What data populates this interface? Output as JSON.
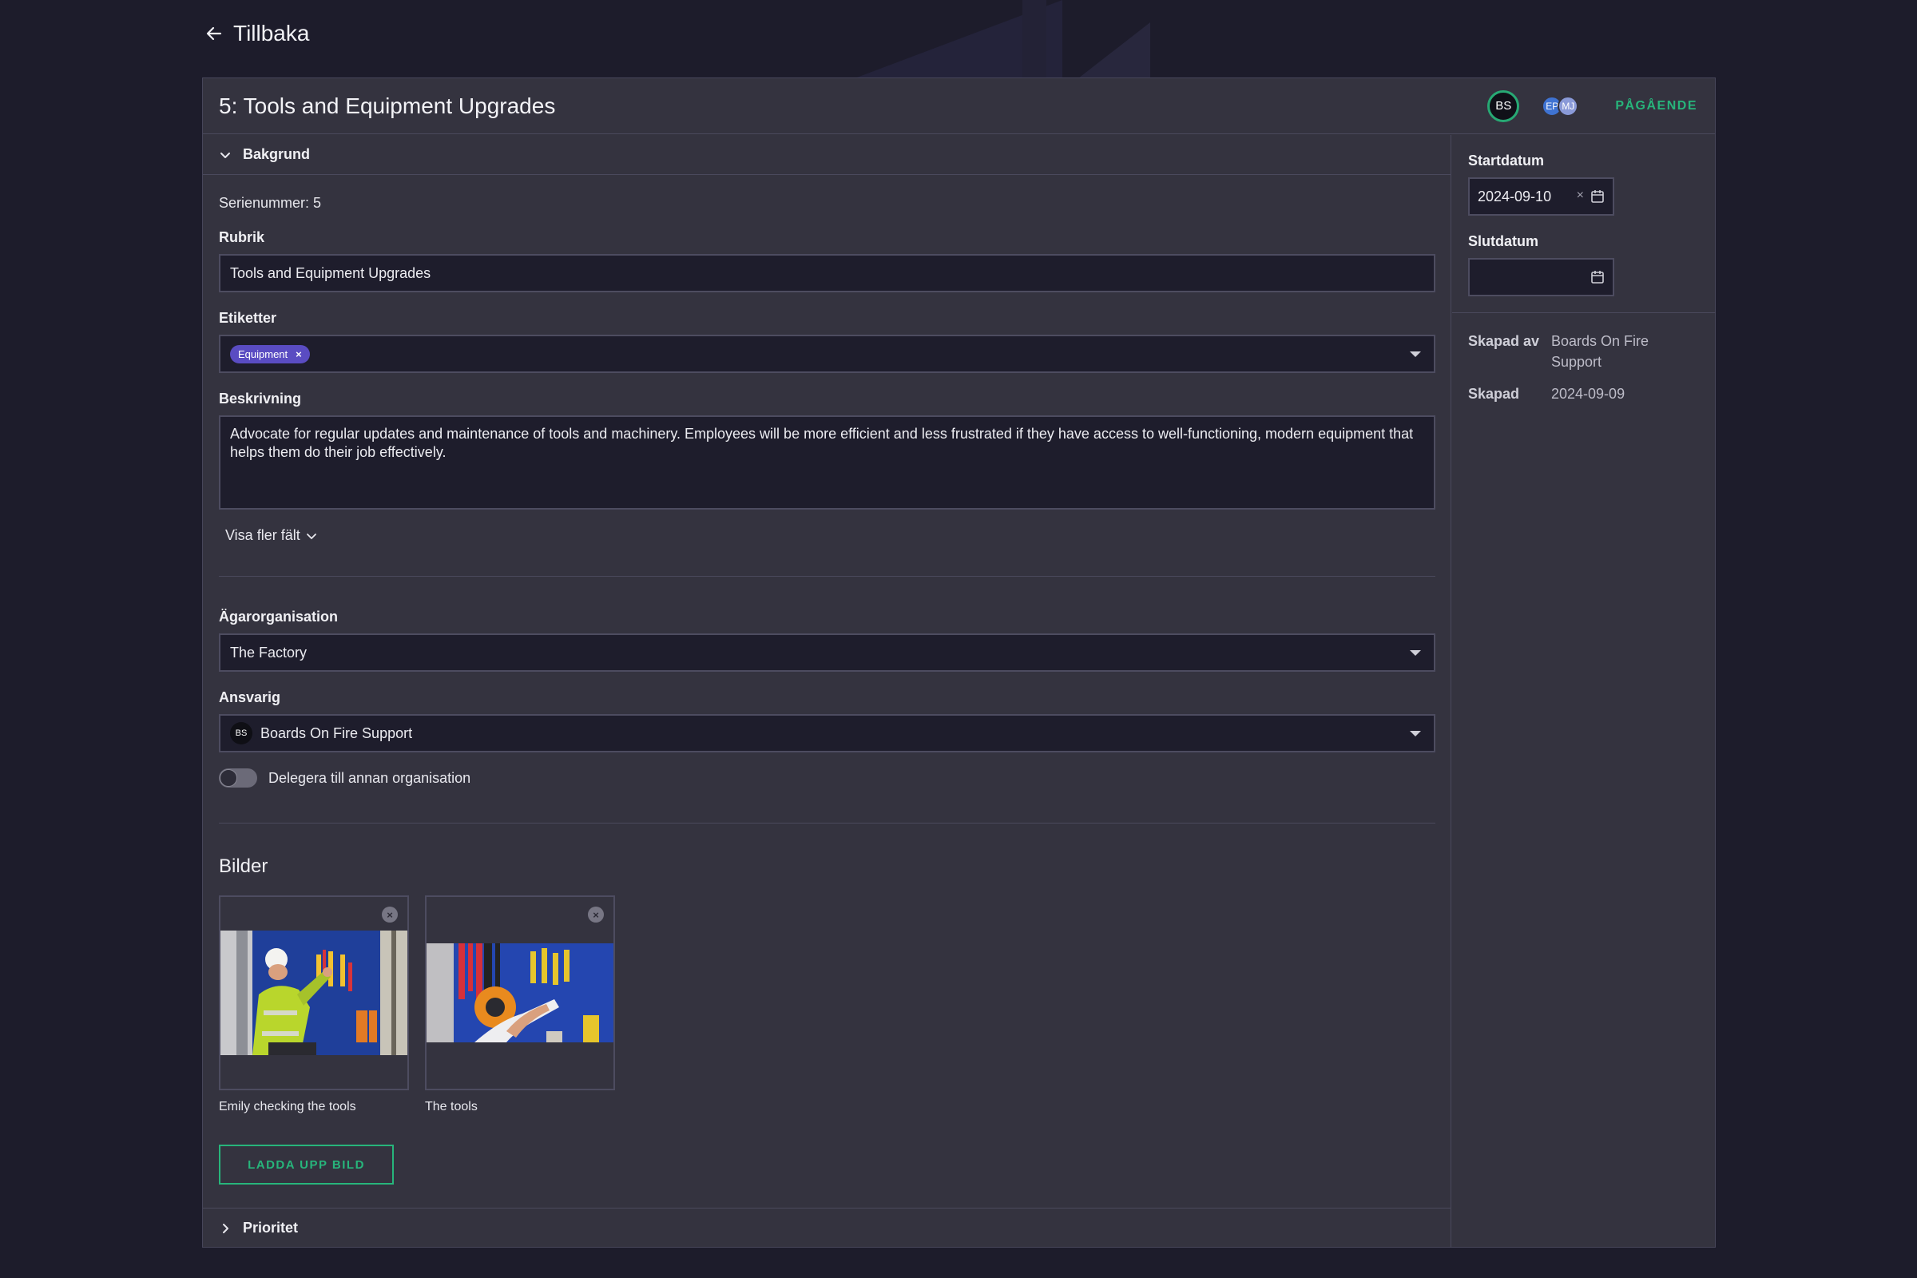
{
  "nav": {
    "back_label": "Tillbaka"
  },
  "header": {
    "title": "5: Tools and Equipment Upgrades",
    "owner_avatar": "BS",
    "members": [
      "EP",
      "MJ"
    ],
    "status": "PÅGÅENDE",
    "status_color": "#27b57b"
  },
  "sections": {
    "bakgrund": "Bakgrund",
    "prioritet": "Prioritet"
  },
  "form": {
    "serial_label": "Serienummer: 5",
    "rubrik_label": "Rubrik",
    "rubrik_value": "Tools and Equipment Upgrades",
    "etiketter_label": "Etiketter",
    "tags": [
      "Equipment"
    ],
    "beskrivning_label": "Beskrivning",
    "beskrivning_value": "Advocate for regular updates and maintenance of tools and machinery. Employees will be more efficient and less frustrated if they have access to well-functioning, modern equipment that helps them do their job effectively.",
    "more_fields": "Visa fler fält",
    "agarorg_label": "Ägarorganisation",
    "agarorg_value": "The Factory",
    "ansvarig_label": "Ansvarig",
    "ansvarig_avatar": "BS",
    "ansvarig_value": "Boards On Fire Support",
    "delegate_label": "Delegera till annan organisation"
  },
  "images": {
    "heading": "Bilder",
    "items": [
      {
        "caption": "Emily checking the tools"
      },
      {
        "caption": "The tools"
      }
    ],
    "upload_label": "LADDA UPP BILD"
  },
  "side": {
    "start_label": "Startdatum",
    "start_value": "2024-09-10",
    "end_label": "Slutdatum",
    "end_value": "",
    "created_by_label": "Skapad av",
    "created_by_value": "Boards On Fire Support",
    "created_label": "Skapad",
    "created_value": "2024-09-09"
  }
}
